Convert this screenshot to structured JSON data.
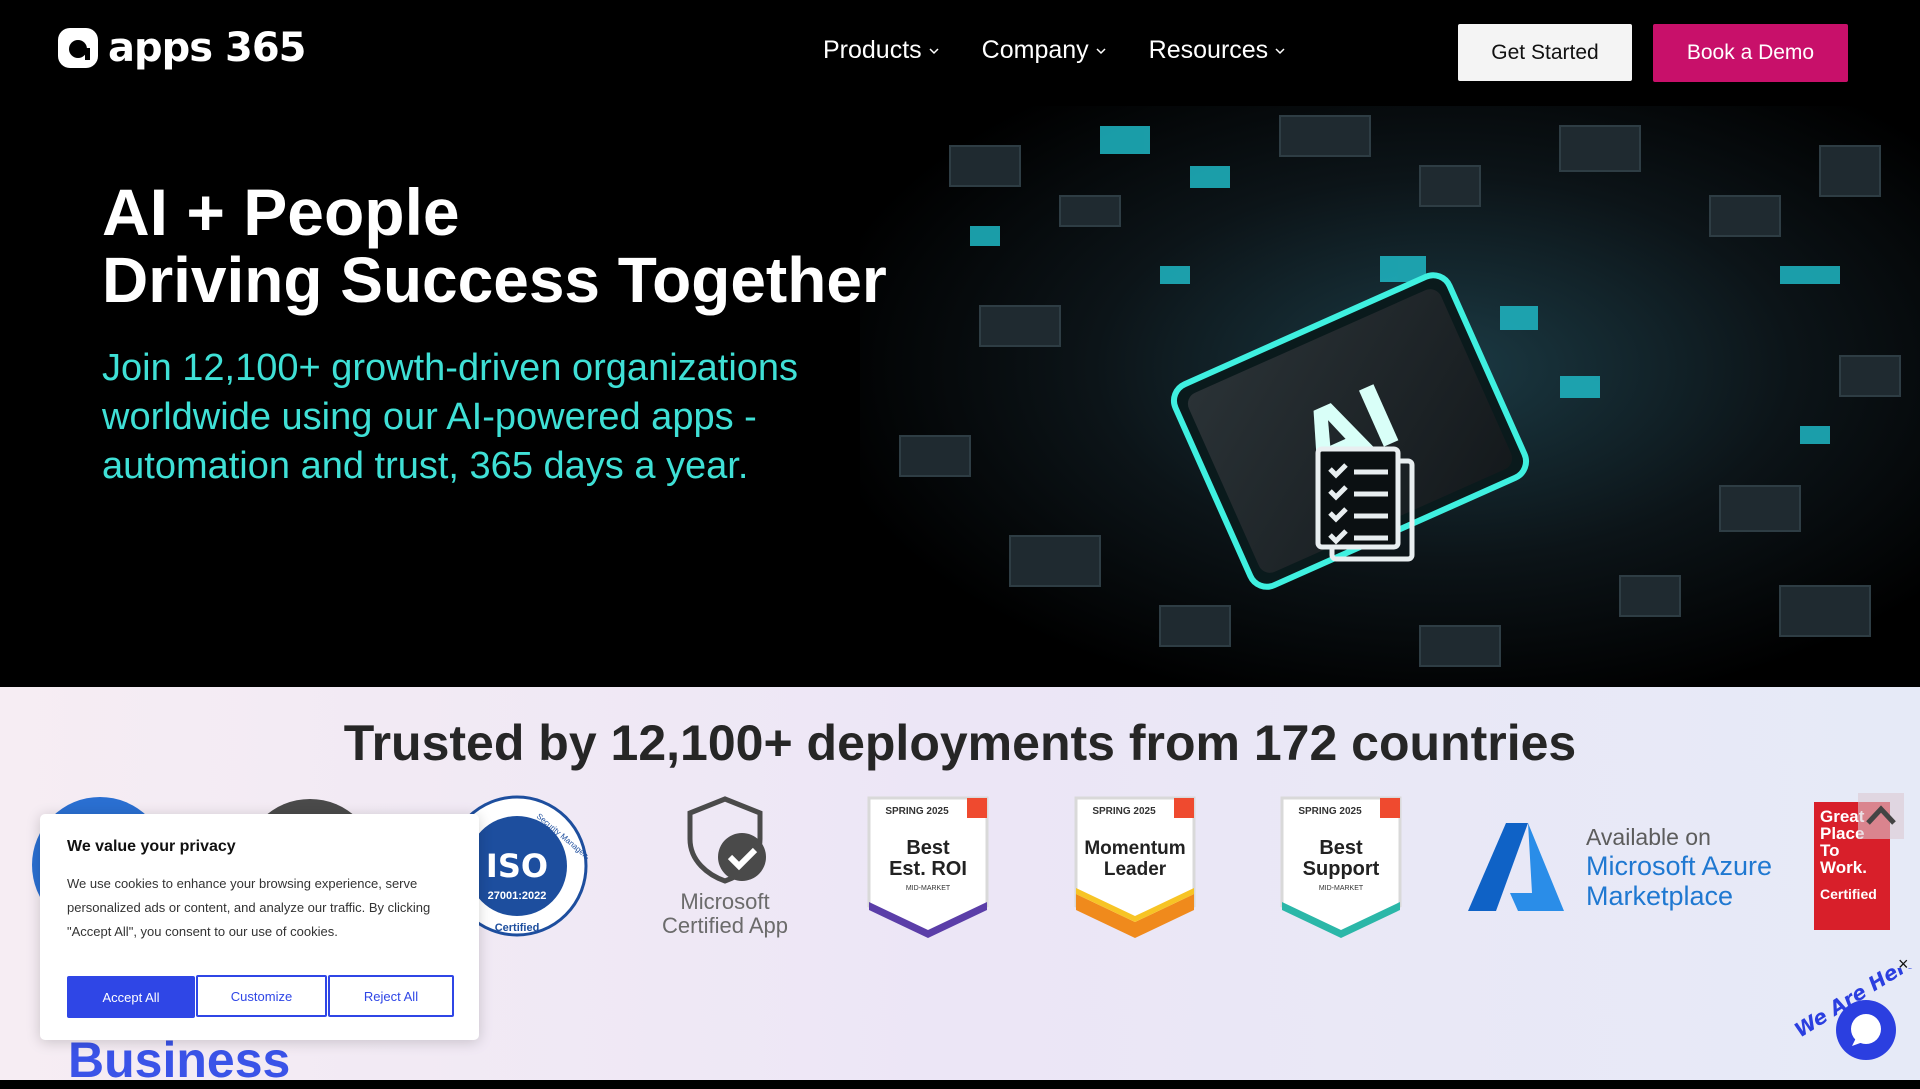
{
  "header": {
    "logo_text": "apps 365",
    "nav": [
      {
        "label": "Products"
      },
      {
        "label": "Company"
      },
      {
        "label": "Resources"
      }
    ],
    "get_started_label": "Get Started",
    "book_demo_label": "Book a Demo"
  },
  "hero": {
    "title": "AI + People",
    "subtitle": "Driving Success Together",
    "body": "Join 12,100+ growth-driven organizations worldwide using our AI-powered apps - automation and trust, 365 days a year.",
    "chip_label": "AI",
    "accent_color": "#3fe0d6"
  },
  "trust": {
    "title": "Trusted by 12,100+ deployments from 172 countries",
    "iso": {
      "ring_text": "Security Management System",
      "code": "ISO",
      "standard": "27001:2022",
      "status": "Certified"
    },
    "ms_app": {
      "line1": "Microsoft",
      "line2": "Certified App"
    },
    "g2_badges": [
      {
        "season": "SPRING 2025",
        "line1": "Best",
        "line2": "Est. ROI",
        "segment": "MID-MARKET",
        "color": "#5b3ea8"
      },
      {
        "season": "SPRING 2025",
        "line1": "Momentum",
        "line2": "Leader",
        "segment": "",
        "color": "#f08a1c"
      },
      {
        "season": "SPRING 2025",
        "line1": "Best",
        "line2": "Support",
        "segment": "MID-MARKET",
        "color": "#2bb7a8"
      }
    ],
    "azure": {
      "line1": "Available on",
      "line2": "Microsoft Azure",
      "line3": "Marketplace"
    },
    "gptw": {
      "line1": "Great",
      "line2": "Place",
      "line3": "To",
      "line4": "Work.",
      "line5": "Certified"
    },
    "section_heading": "Business"
  },
  "cookie": {
    "title": "We value your privacy",
    "text": "We use cookies to enhance your browsing experience, serve personalized ads or content, and analyze our traffic. By clicking \"Accept All\", you consent to our use of cookies.",
    "accept_label": "Accept All",
    "customize_label": "Customize",
    "reject_label": "Reject All"
  },
  "chat": {
    "close_label": "×",
    "tag_text": "We Are Here!"
  },
  "colors": {
    "brand_pink": "#c8106a",
    "brand_blue": "#2f46e6",
    "teal": "#3fe0d6"
  }
}
